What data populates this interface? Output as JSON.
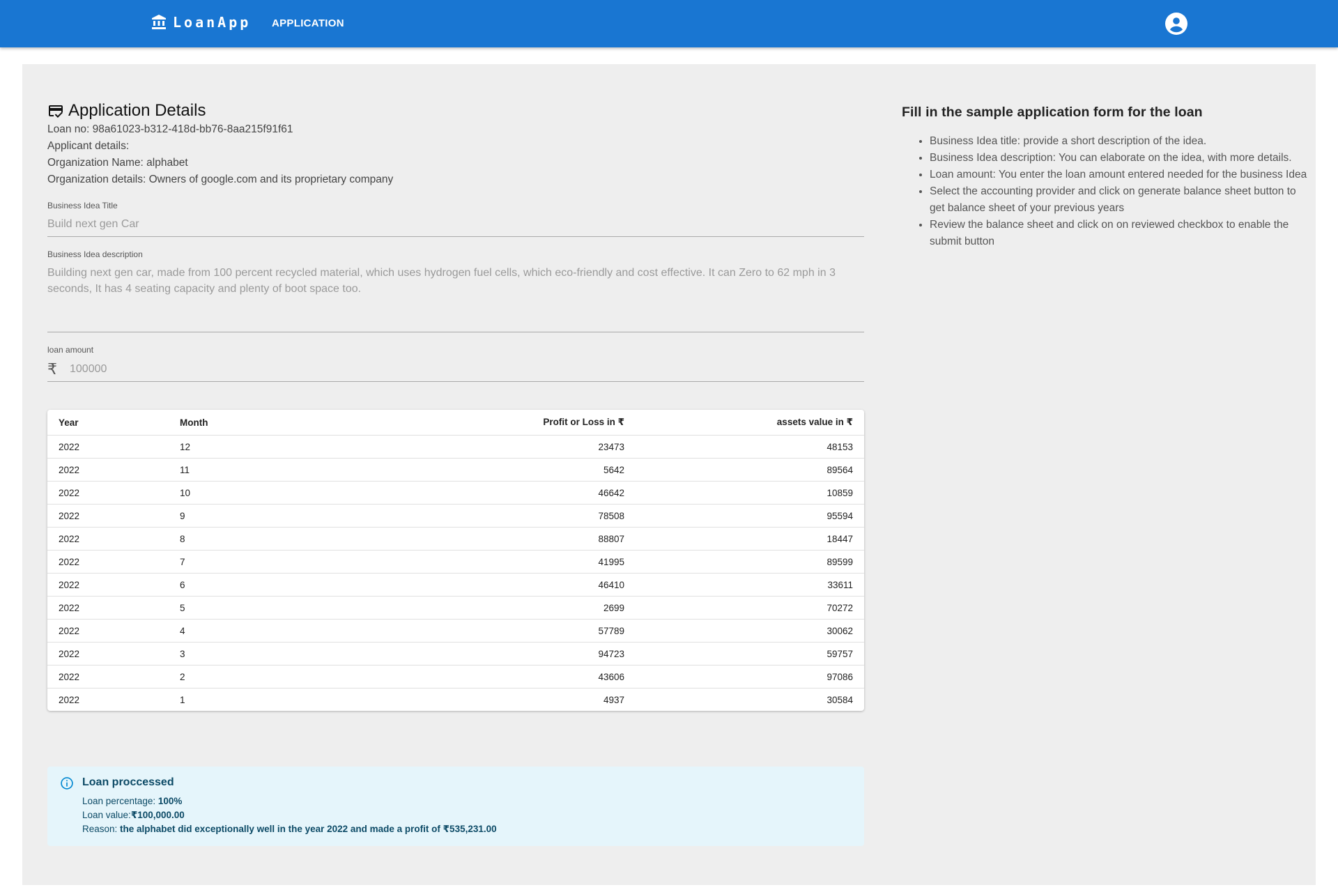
{
  "header": {
    "brand": "LoanApp",
    "nav_application": "APPLICATION"
  },
  "details": {
    "title": "Application Details",
    "loan_no": "Loan no: 98a61023-b312-418d-bb76-8aa215f91f61",
    "applicant_details": "Applicant details:",
    "org_name": "Organization Name: alphabet",
    "org_details": "Organization details: Owners of google.com and its proprietary company"
  },
  "form": {
    "idea_title_label": "Business Idea Title",
    "idea_title_value": "Build next gen Car",
    "idea_desc_label": "Business Idea description",
    "idea_desc_value": "Building next gen car, made from 100 percent recycled material, which uses hydrogen fuel cells, which eco-friendly and cost effective. It can Zero to 62 mph in 3 seconds, It has 4 seating capacity and plenty of boot space too.",
    "loan_amount_label": "loan amount",
    "currency_symbol": "₹",
    "loan_amount_value": "100000"
  },
  "table": {
    "headers": [
      "Year",
      "Month",
      "Profit or Loss in ₹",
      "assets value in ₹"
    ],
    "rows": [
      [
        "2022",
        "12",
        "23473",
        "48153"
      ],
      [
        "2022",
        "11",
        "5642",
        "89564"
      ],
      [
        "2022",
        "10",
        "46642",
        "10859"
      ],
      [
        "2022",
        "9",
        "78508",
        "95594"
      ],
      [
        "2022",
        "8",
        "88807",
        "18447"
      ],
      [
        "2022",
        "7",
        "41995",
        "89599"
      ],
      [
        "2022",
        "6",
        "46410",
        "33611"
      ],
      [
        "2022",
        "5",
        "2699",
        "70272"
      ],
      [
        "2022",
        "4",
        "57789",
        "30062"
      ],
      [
        "2022",
        "3",
        "94723",
        "59757"
      ],
      [
        "2022",
        "2",
        "43606",
        "97086"
      ],
      [
        "2022",
        "1",
        "4937",
        "30584"
      ]
    ]
  },
  "alert": {
    "title": "Loan proccessed",
    "percentage_label": "Loan percentage: ",
    "percentage_value": "100%",
    "value_label": "Loan value:",
    "value_value": "₹100,000.00",
    "reason_label": "Reason: ",
    "reason_value": "the alphabet did exceptionally well in the year 2022 and made a profit of ₹535,231.00"
  },
  "help": {
    "title": "Fill in the sample application form for the loan",
    "items": [
      "Business Idea title: provide a short description of the idea.",
      "Business Idea description: You can elaborate on the idea, with more details.",
      "Loan amount: You enter the loan amount entered needed for the business Idea",
      "Select the accounting provider and click on generate balance sheet button to get balance sheet of your previous years",
      "Review the balance sheet and click on on reviewed checkbox to enable the submit button"
    ]
  },
  "colors": {
    "appbar": "#1976d2",
    "panel": "#eeeeee",
    "alert_bg": "#e5f5fb",
    "alert_text": "#0c4a66"
  },
  "icons": {
    "brand": "bank-icon",
    "account": "account-circle-icon",
    "title": "credit-score-icon",
    "alert": "info-icon",
    "currency": "rupee-icon"
  }
}
